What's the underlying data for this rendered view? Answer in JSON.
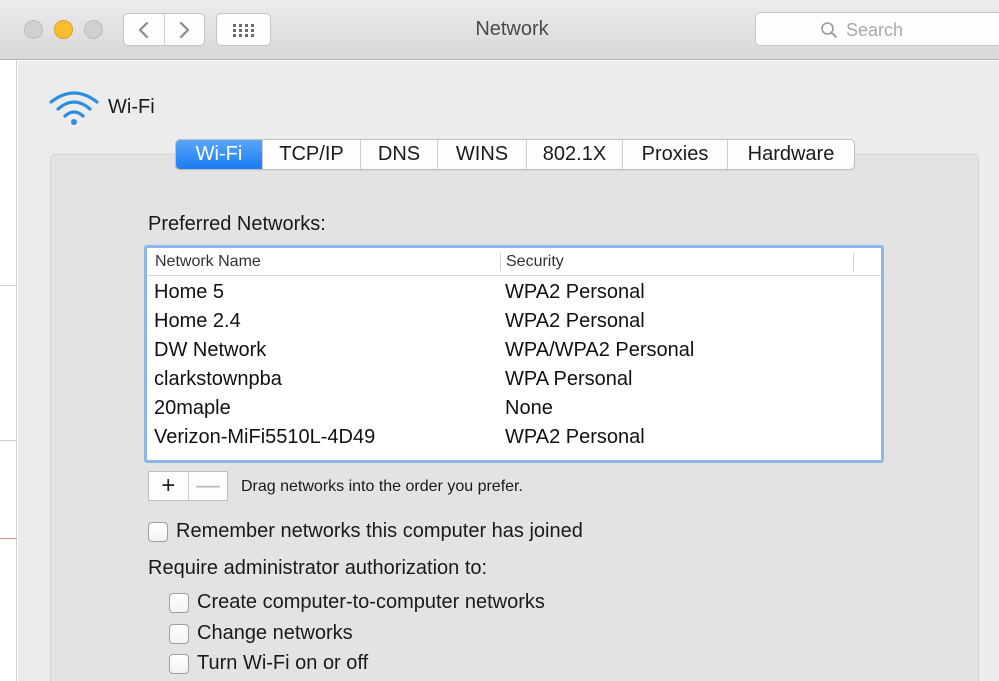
{
  "window": {
    "title": "Network"
  },
  "search": {
    "placeholder": "Search"
  },
  "pane": {
    "title": "Wi-Fi"
  },
  "tabs": [
    {
      "label": "Wi-Fi",
      "active": true
    },
    {
      "label": "TCP/IP",
      "active": false
    },
    {
      "label": "DNS",
      "active": false
    },
    {
      "label": "WINS",
      "active": false
    },
    {
      "label": "802.1X",
      "active": false
    },
    {
      "label": "Proxies",
      "active": false
    },
    {
      "label": "Hardware",
      "active": false
    }
  ],
  "preferred": {
    "label": "Preferred Networks:",
    "columns": {
      "name": "Network Name",
      "security": "Security"
    },
    "rows": [
      {
        "name": "Home 5",
        "security": "WPA2 Personal"
      },
      {
        "name": "Home 2.4",
        "security": "WPA2 Personal"
      },
      {
        "name": "DW Network",
        "security": "WPA/WPA2 Personal"
      },
      {
        "name": "clarkstownpba",
        "security": "WPA Personal"
      },
      {
        "name": "20maple",
        "security": "None"
      },
      {
        "name": "Verizon-MiFi5510L-4D49",
        "security": "WPA2 Personal"
      }
    ],
    "add_label": "+",
    "remove_label": "—",
    "hint": "Drag networks into the order you prefer."
  },
  "options": {
    "remember": {
      "label": "Remember networks this computer has joined",
      "checked": false
    },
    "require_label": "Require administrator authorization to:",
    "admin": [
      {
        "label": "Create computer-to-computer networks",
        "checked": false
      },
      {
        "label": "Change networks",
        "checked": false
      },
      {
        "label": "Turn Wi-Fi on or off",
        "checked": false
      }
    ]
  },
  "colors": {
    "accent": "#1a7cf3",
    "minimize": "#fbbd2e",
    "focus_ring": "#8cb7ec",
    "wifi_icon": "#2a8de0"
  },
  "icons": {
    "back": "chevron-left-icon",
    "forward": "chevron-right-icon",
    "show_all": "grid-icon",
    "search": "search-icon",
    "wifi": "wifi-icon"
  }
}
